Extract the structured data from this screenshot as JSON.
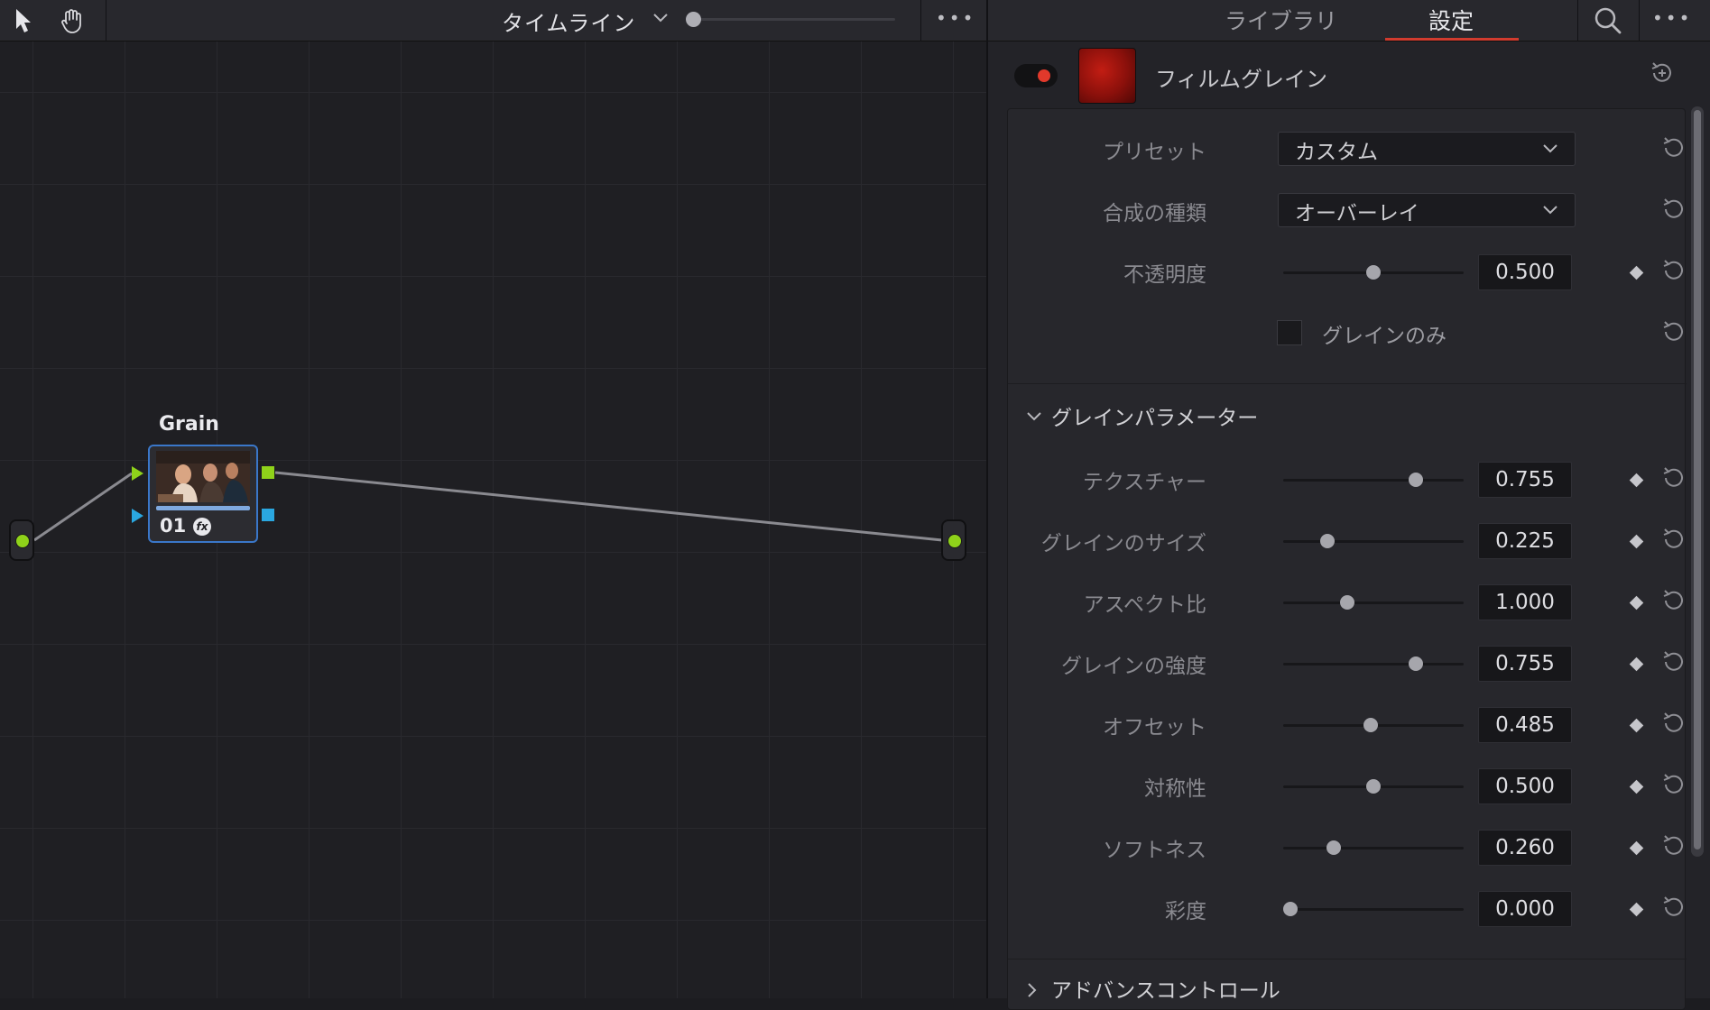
{
  "node_editor": {
    "timeline_label": "タイムライン",
    "zoom_level": 0.03,
    "node": {
      "title": "Grain",
      "number": "01",
      "fx_label": "fx"
    }
  },
  "inspector": {
    "tabs": [
      {
        "label": "ライブラリ",
        "active": false
      },
      {
        "label": "設定",
        "active": true
      }
    ],
    "effect": {
      "name": "フィルムグレイン",
      "enabled": true,
      "toggle_color": "#e1392b"
    },
    "top_params": {
      "preset": {
        "label": "プリセット",
        "value": "カスタム"
      },
      "composite": {
        "label": "合成の種類",
        "value": "オーバーレイ"
      },
      "opacity": {
        "label": "不透明度",
        "value": "0.500",
        "fraction": 0.5
      },
      "grain_only": {
        "label": "グレインのみ",
        "checked": false
      }
    },
    "grain_section": {
      "title": "グレインパラメーター",
      "expanded": true,
      "params": [
        {
          "label": "テクスチャー",
          "value": "0.755",
          "fraction": 0.755
        },
        {
          "label": "グレインのサイズ",
          "value": "0.225",
          "fraction": 0.225
        },
        {
          "label": "アスペクト比",
          "value": "1.000",
          "fraction": 0.34
        },
        {
          "label": "グレインの強度",
          "value": "0.755",
          "fraction": 0.755
        },
        {
          "label": "オフセット",
          "value": "0.485",
          "fraction": 0.485
        },
        {
          "label": "対称性",
          "value": "0.500",
          "fraction": 0.5
        },
        {
          "label": "ソフトネス",
          "value": "0.260",
          "fraction": 0.26
        },
        {
          "label": "彩度",
          "value": "0.000",
          "fraction": 0.0
        }
      ]
    },
    "advanced_section": {
      "title": "アドバンスコントロール",
      "expanded": false
    }
  },
  "colors": {
    "accent_red": "#d13b2e",
    "node_port_green": "#8fd21a",
    "node_port_blue": "#2aa7e0",
    "node_selected": "#3a77c9"
  }
}
